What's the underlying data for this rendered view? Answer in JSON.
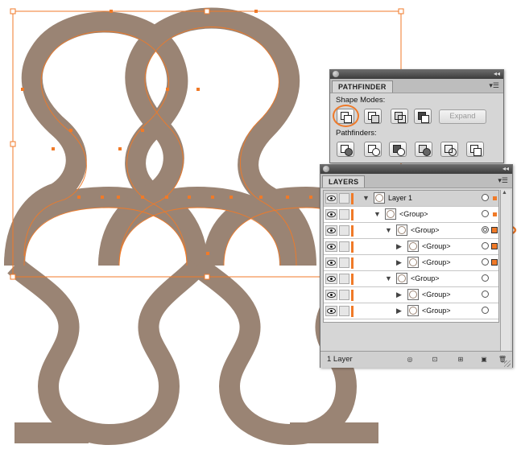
{
  "colors": {
    "artwork_fill": "#9a8474",
    "selection": "#f07a28",
    "highlight_ring": "#ef7a2a",
    "panel_bg": "#d6d6d6"
  },
  "pathfinder": {
    "tab": "PATHFINDER",
    "shape_modes_label": "Shape Modes:",
    "shape_mode_buttons": [
      "unite-icon",
      "minus-front-icon",
      "intersect-icon",
      "exclude-icon"
    ],
    "expand_label": "Expand",
    "pathfinders_label": "Pathfinders:",
    "pathfinder_buttons": [
      "divide-icon",
      "trim-icon",
      "merge-icon",
      "crop-icon",
      "outline-icon",
      "minus-back-icon"
    ],
    "highlighted_button": "unite-icon"
  },
  "layers": {
    "tab": "LAYERS",
    "rows": [
      {
        "label": "Layer 1",
        "indent": 0,
        "expanded": true,
        "kind": "layer",
        "selected_marker": "small"
      },
      {
        "label": "<Group>",
        "indent": 1,
        "expanded": true,
        "kind": "group",
        "selected_marker": "small"
      },
      {
        "label": "<Group>",
        "indent": 2,
        "expanded": true,
        "kind": "group",
        "selected_marker": "big",
        "targeted": true
      },
      {
        "label": "<Group>",
        "indent": 3,
        "expanded": false,
        "kind": "group",
        "selected_marker": "big"
      },
      {
        "label": "<Group>",
        "indent": 3,
        "expanded": false,
        "kind": "group",
        "selected_marker": "big"
      },
      {
        "label": "<Group>",
        "indent": 2,
        "expanded": true,
        "kind": "group",
        "selected_marker": "none"
      },
      {
        "label": "<Group>",
        "indent": 3,
        "expanded": false,
        "kind": "group",
        "selected_marker": "none"
      },
      {
        "label": "<Group>",
        "indent": 3,
        "expanded": false,
        "kind": "group",
        "selected_marker": "none"
      }
    ],
    "footer": {
      "count": "1 Layer",
      "icons": [
        "locate-object-icon",
        "make-clipping-mask-icon",
        "new-sublayer-icon",
        "new-layer-icon",
        "trash-icon"
      ]
    }
  }
}
